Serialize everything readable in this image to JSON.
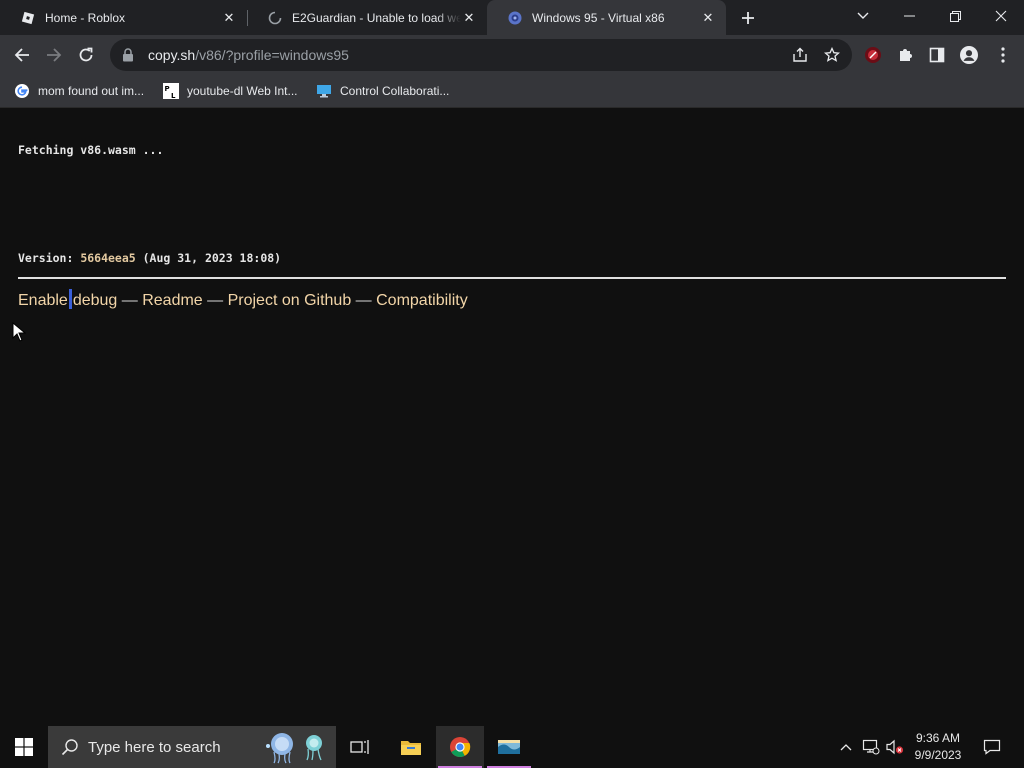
{
  "browser": {
    "tabs": [
      {
        "title": "Home - Roblox",
        "favicon": "roblox-icon",
        "active": false
      },
      {
        "title": "E2Guardian - Unable to load web",
        "favicon": "loading-spinner-icon",
        "active": false
      },
      {
        "title": "Windows 95 - Virtual x86",
        "favicon": "v86-icon",
        "active": true
      }
    ],
    "address": {
      "host": "copy.sh",
      "path": "/v86/?profile=windows95"
    },
    "bookmarks": [
      {
        "label": "mom found out im...",
        "icon": "google-icon"
      },
      {
        "label": "youtube-dl Web Int...",
        "icon": "yt-dl-icon"
      },
      {
        "label": "Control Collaborati...",
        "icon": "monitor-icon"
      }
    ]
  },
  "page": {
    "log_line": "Fetching v86.wasm ...",
    "version_label": "Version: ",
    "version_hash": "5664eea5",
    "version_date": " (Aug 31, 2023 18:08)",
    "links": {
      "enable": "Enable",
      "debug": "debug",
      "sep": " — ",
      "readme": "Readme",
      "github": "Project on Github",
      "compat": "Compatibility"
    }
  },
  "taskbar": {
    "search_placeholder": "Type here to search",
    "time": "9:36 AM",
    "date": "9/9/2023"
  },
  "colors": {
    "page_bg": "#101010",
    "link": "#f2d5a8",
    "hash": "#e3c9a0",
    "tab_active": "#35363a",
    "tab_strip": "#202124"
  }
}
